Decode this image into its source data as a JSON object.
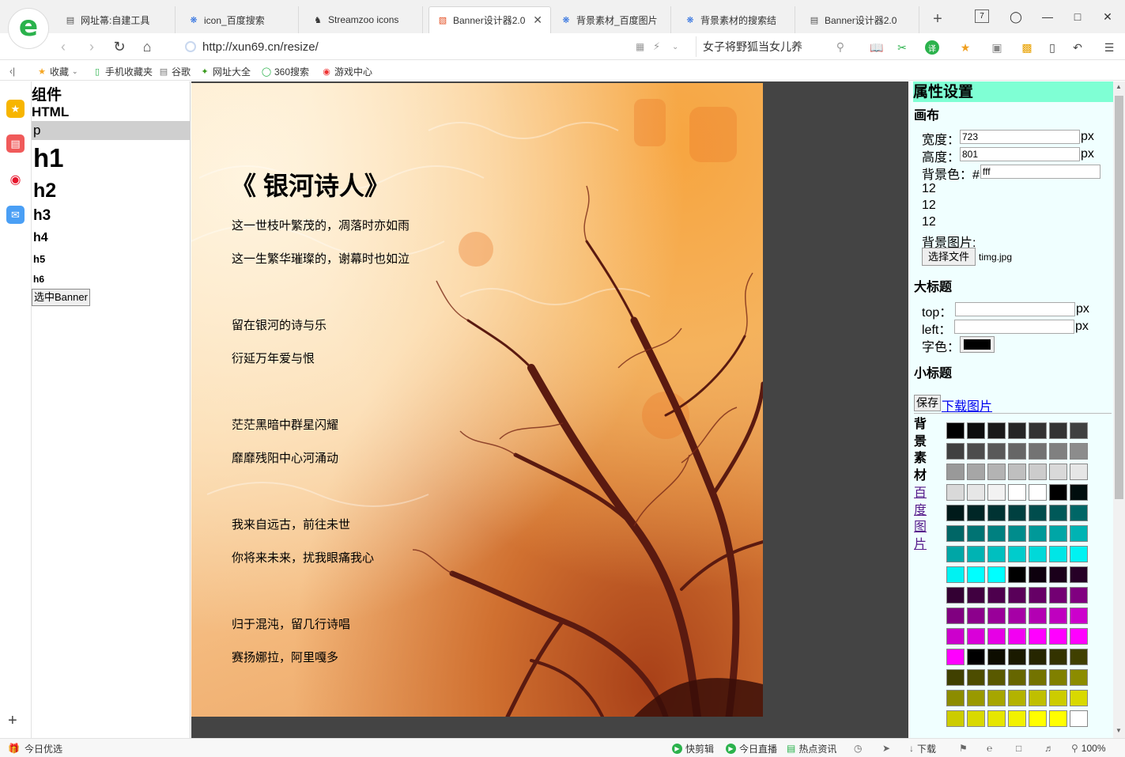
{
  "tabs": [
    {
      "label": "网址箒:自建工具",
      "icon": "page-icon",
      "active": false
    },
    {
      "label": "icon_百度搜索",
      "icon": "baidu-paw-icon",
      "active": false
    },
    {
      "label": "Streamzoo icons",
      "icon": "streamzoo-icon",
      "active": false
    },
    {
      "label": "Banner设计器2.0",
      "icon": "banner-icon",
      "active": true
    },
    {
      "label": "背景素材_百度图片",
      "icon": "baidu-paw-icon",
      "active": false
    },
    {
      "label": "背景素材的搜索结",
      "icon": "baidu-paw-icon",
      "active": false
    },
    {
      "label": "Banner设计器2.0",
      "icon": "page-icon",
      "active": false
    }
  ],
  "tab_count_badge": "7",
  "nav": {
    "url": "http://xun69.cn/resize/",
    "search_text": "女子将野狐当女儿养"
  },
  "bookmarks": [
    {
      "label": "收藏",
      "icon": "star-icon"
    },
    {
      "label": "手机收藏夹",
      "icon": "phone-icon"
    },
    {
      "label": "谷歌",
      "icon": "page-icon"
    },
    {
      "label": "网址大全",
      "icon": "compass-icon"
    },
    {
      "label": "360搜索",
      "icon": "search-360-icon"
    },
    {
      "label": "游戏中心",
      "icon": "game-icon"
    }
  ],
  "components": {
    "title": "组件",
    "html": "HTML",
    "items": [
      "p",
      "h1",
      "h2",
      "h3",
      "h4",
      "h5",
      "h6"
    ],
    "select_banner": "选中Banner"
  },
  "poem": {
    "title": "《 银河诗人》",
    "lines": [
      "这一世枝叶繁茂的，凋落时亦如雨",
      "这一生繁华璀璨的，谢幕时也如泣",
      "",
      "留在银河的诗与乐",
      "衍延万年爱与恨",
      "",
      "茫茫黑暗中群星闪耀",
      "靡靡残阳中心河涌动",
      "",
      "我来自远古，前往未世",
      "你将来未来，扰我眼痛我心",
      "",
      "归于混沌，留几行诗唱",
      "赛扬娜拉，阿里嘎多"
    ]
  },
  "props": {
    "header": "属性设置",
    "canvas_label": "画布",
    "width_label": "宽度：",
    "width_value": "723",
    "height_label": "高度：",
    "height_value": "801",
    "unit": "px",
    "bg_label": "背景色：#",
    "bg_value": "fff",
    "nums": [
      "12",
      "12",
      "12"
    ],
    "bgimg_label": "背景图片:",
    "choose_file": "选择文件",
    "file_name": "timg.jpg",
    "title_label": "大标题",
    "top_label": "top：",
    "left_label": "left：",
    "font_color_label": "字色：",
    "subtitle_label": "小标题",
    "save": "保存",
    "download": "下载图片",
    "material_label": "背景素材",
    "baidu_link": "百度图片"
  },
  "swatches": [
    "#000000",
    "#0d0d0d",
    "#1a1a1a",
    "#262626",
    "#333333",
    "#333333",
    "#404040",
    "#404040",
    "#4d4d4d",
    "#595959",
    "#666666",
    "#737373",
    "#808080",
    "#8c8c8c",
    "#999999",
    "#a6a6a6",
    "#b3b3b3",
    "#bfbfbf",
    "#cccccc",
    "#d9d9d9",
    "#e6e6e6",
    "#d9d9d9",
    "#e6e6e6",
    "#f2f2f2",
    "#ffffff",
    "#ffffff",
    "#000000",
    "#000d0d",
    "#001a1a",
    "#002626",
    "#003333",
    "#004040",
    "#004d4d",
    "#005959",
    "#006666",
    "#006666",
    "#007373",
    "#008080",
    "#008c8c",
    "#009999",
    "#00a6a6",
    "#00b3b3",
    "#00a6a6",
    "#00b3b3",
    "#00bfbf",
    "#00cccc",
    "#00d9d9",
    "#00e6e6",
    "#00f2f2",
    "#00f2f2",
    "#00ffff",
    "#00ffff",
    "#000000",
    "#0d000d",
    "#1a001a",
    "#260026",
    "#330033",
    "#400040",
    "#4d004d",
    "#590059",
    "#660066",
    "#730073",
    "#800080",
    "#800080",
    "#8c008c",
    "#990099",
    "#a600a6",
    "#b300b3",
    "#bf00bf",
    "#cc00cc",
    "#cc00cc",
    "#d900d9",
    "#e600e6",
    "#f200f2",
    "#ff00ff",
    "#ff00ff",
    "#ff00ff",
    "#ff00ff",
    "#000000",
    "#0d0d00",
    "#1a1a00",
    "#262600",
    "#333300",
    "#404000",
    "#404000",
    "#4d4d00",
    "#595900",
    "#666600",
    "#737300",
    "#808000",
    "#8c8c00",
    "#8c8c00",
    "#999900",
    "#a6a600",
    "#b3b300",
    "#bfbf00",
    "#cccc00",
    "#d9d900",
    "#cccc00",
    "#d9d900",
    "#e6e600",
    "#f2f200",
    "#ffff00",
    "#ffff00",
    "#ffffff"
  ],
  "status": {
    "left": "今日优选",
    "right": [
      "快剪辑",
      "今日直播",
      "热点资讯",
      "下载",
      "100%"
    ]
  },
  "colors": {
    "accent_green": "#2bb24c",
    "props_bg": "#f0ffff",
    "props_header": "#7fffd4",
    "stage_bg": "#444444"
  }
}
